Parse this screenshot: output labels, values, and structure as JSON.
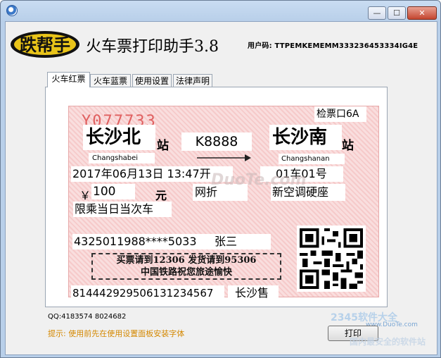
{
  "window": {
    "min_glyph": "—",
    "max_glyph": "☐",
    "close_glyph": "✕"
  },
  "header": {
    "logo_text": "跌帮手",
    "title": "火车票打印助手3.8",
    "user_code": "用户码: TTPEMKEMEMM333236453334IG4E"
  },
  "tabs": [
    {
      "label": "火车红票",
      "active": true
    },
    {
      "label": "火车蓝票",
      "active": false
    },
    {
      "label": "使用设置",
      "active": false
    },
    {
      "label": "法律声明",
      "active": false
    }
  ],
  "ticket": {
    "serial": "Y077733",
    "gate": "检票口6A",
    "from_station": "长沙北",
    "from_pinyin": "Changshabei",
    "station_suffix_1": "站",
    "train_no": "K8888",
    "to_station": "长沙南",
    "to_pinyin": "Changshanan",
    "station_suffix_2": "站",
    "datetime": "2017年06月13日 13:47开",
    "car_seat": "01车01号",
    "price_symbol": "￥",
    "price": "100",
    "price_unit": "元",
    "discount": "网折",
    "seat_type": "新空调硬座",
    "validity": "限乘当日当次车",
    "passenger_id": "4325011988****5033",
    "passenger_name": "张三",
    "notice_line1": "买票请到12306  发货请到95306",
    "notice_line2": "中国铁路祝您旅途愉快",
    "ticket_code": "81444292950613123456",
    "ticket_code_tail": "7",
    "sale_station": "长沙售"
  },
  "footer": {
    "qq": "QQ:4183574    8024682",
    "hint": "提示: 使用前先在使用设置面板安装字体",
    "print_label": "打印"
  },
  "watermark": {
    "text": "DuoTe.com",
    "brand": "2345软件大全",
    "brand_url": "www.DuoTe.com",
    "brand_tagline": "国内最安全的软件站"
  }
}
